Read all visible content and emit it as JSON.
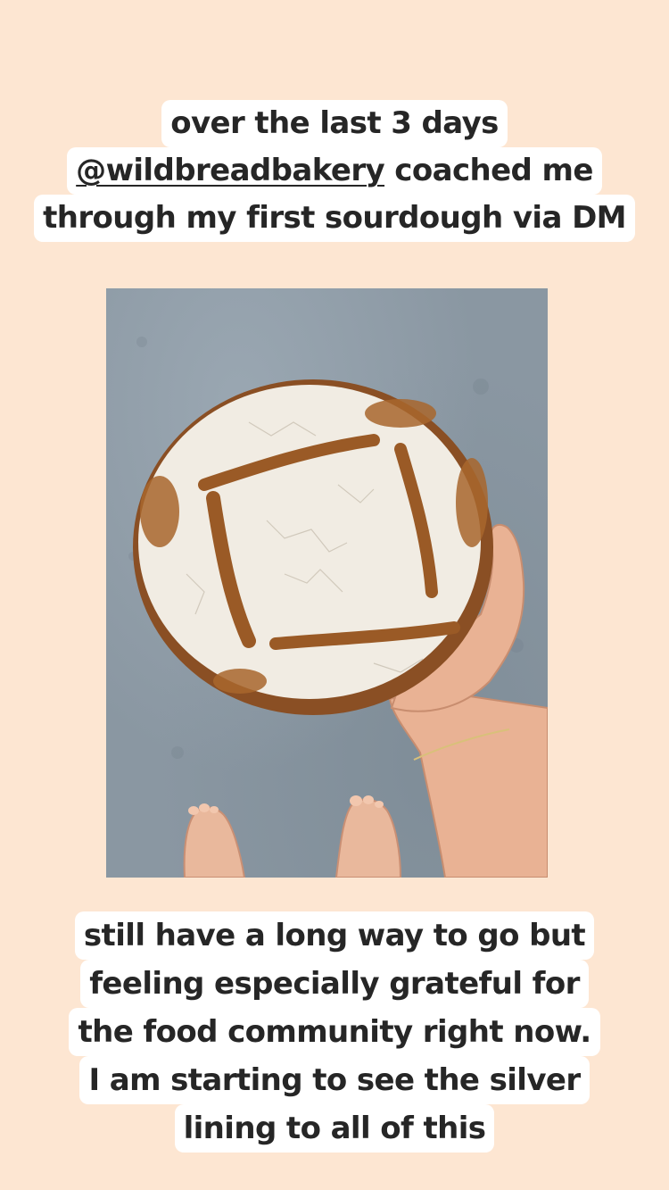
{
  "story": {
    "top_caption": {
      "line1": "over the last 3 days",
      "mention": "@wildbreadbakery",
      "line2_rest": " coached me",
      "line3": "through my first sourdough via DM"
    },
    "photo": {
      "subject": "sourdough loaf held in hand over grey floor with bare feet"
    },
    "bottom_caption": {
      "lines": [
        "still have a long way to go but",
        "feeling especially grateful for",
        "the food community right now.",
        "I am starting to see the silver",
        "lining to all of this"
      ]
    }
  }
}
